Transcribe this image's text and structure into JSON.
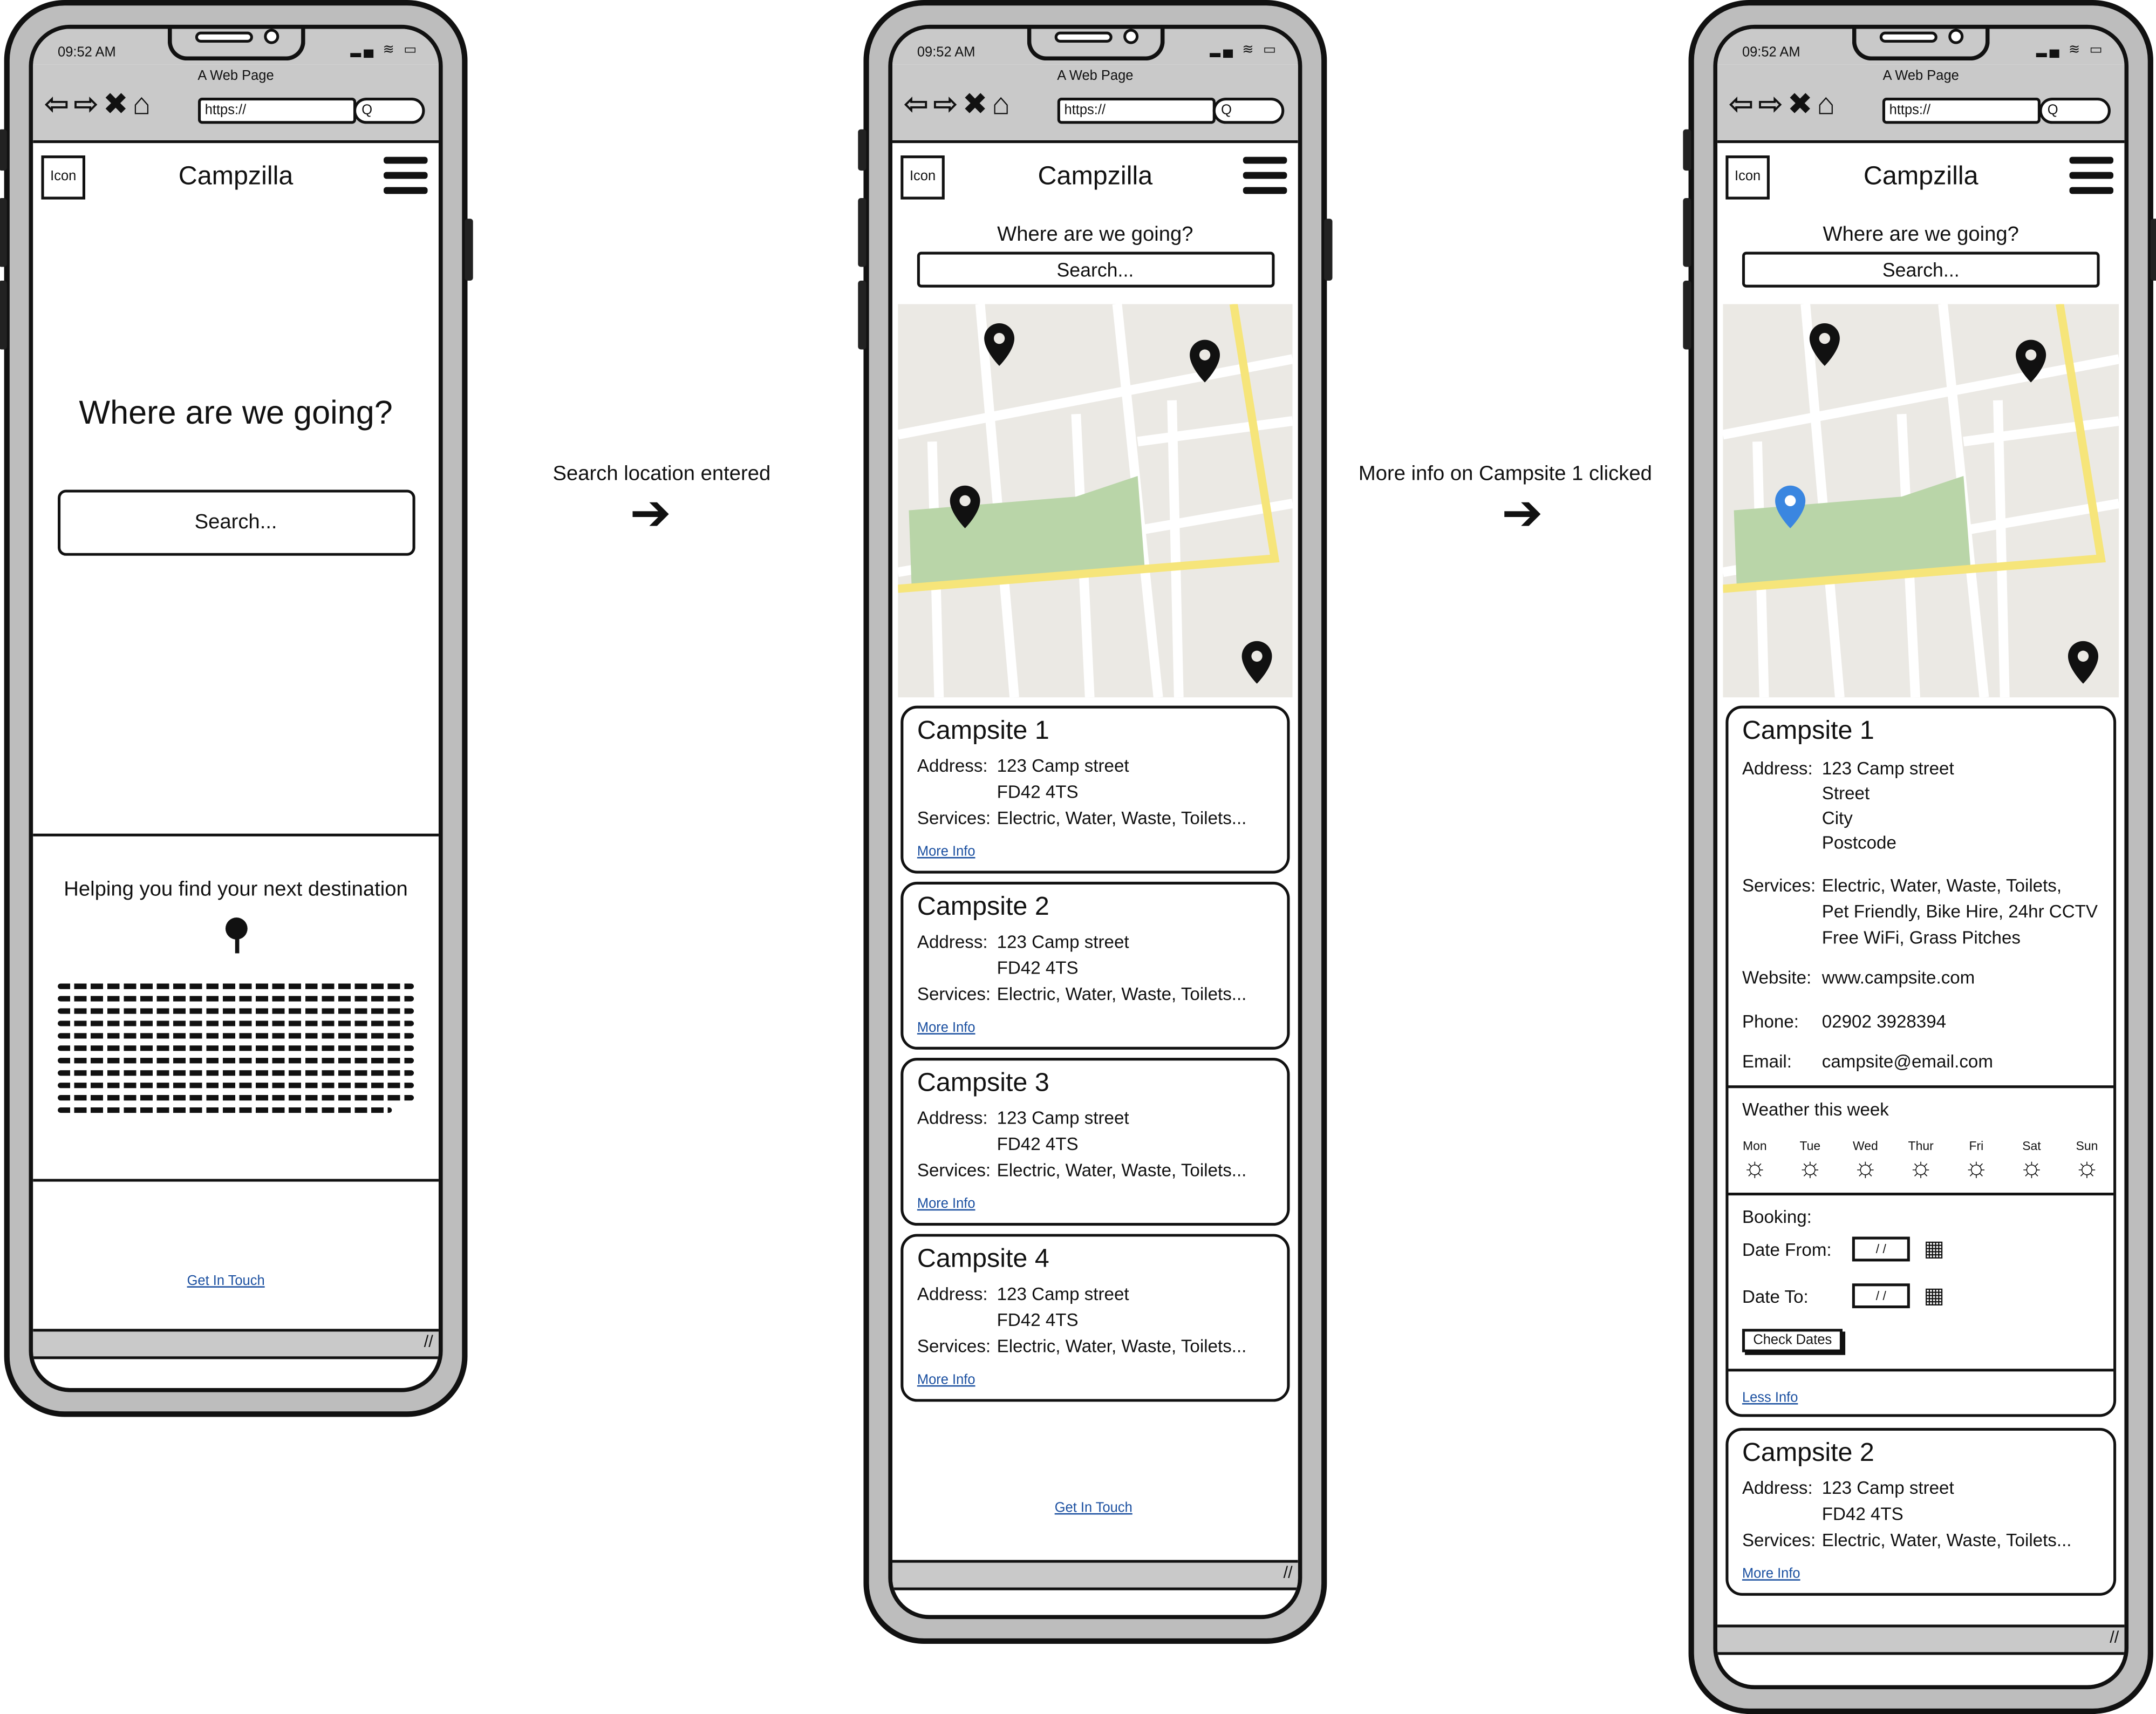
{
  "common": {
    "status_time": "09:52 AM",
    "page_title": "A Web Page",
    "url": "https://",
    "search_glyph": "Q",
    "icon_label": "Icon",
    "brand": "Campzilla",
    "subhead": "Where are we going?",
    "search_placeholder": "Search...",
    "footer_link": "Get In Touch",
    "more_info": "More Info",
    "less_info": "Less Info"
  },
  "transitions": [
    {
      "label": "Search location entered"
    },
    {
      "label": "More info on Campsite 1 clicked"
    }
  ],
  "screen1": {
    "hero": "Where are we going?",
    "search": "Search...",
    "tagline": "Helping you find your next destination"
  },
  "screen2": {
    "campsites": [
      {
        "title": "Campsite 1",
        "address_label": "Address:",
        "address_line1": "123 Camp street",
        "address_line2": "FD42 4TS",
        "services_label": "Services:",
        "services": "Electric, Water, Waste, Toilets..."
      },
      {
        "title": "Campsite 2",
        "address_label": "Address:",
        "address_line1": "123 Camp street",
        "address_line2": "FD42 4TS",
        "services_label": "Services:",
        "services": "Electric, Water, Waste, Toilets..."
      },
      {
        "title": "Campsite 3",
        "address_label": "Address:",
        "address_line1": "123 Camp street",
        "address_line2": "FD42 4TS",
        "services_label": "Services:",
        "services": "Electric, Water, Waste, Toilets..."
      },
      {
        "title": "Campsite 4",
        "address_label": "Address:",
        "address_line1": "123 Camp street",
        "address_line2": "FD42 4TS",
        "services_label": "Services:",
        "services": "Electric, Water, Waste, Toilets..."
      }
    ]
  },
  "screen3": {
    "detail": {
      "title": "Campsite 1",
      "address_label": "Address:",
      "address_lines": [
        "123 Camp street",
        "Street",
        "City",
        "Postcode"
      ],
      "services_label": "Services:",
      "services_lines": [
        "Electric, Water, Waste, Toilets,",
        "Pet Friendly, Bike Hire, 24hr CCTV",
        "Free WiFi, Grass Pitches"
      ],
      "website_label": "Website:",
      "website": "www.campsite.com",
      "phone_label": "Phone:",
      "phone": "02902 3928394",
      "email_label": "Email:",
      "email": "campsite@email.com",
      "weather_title": "Weather this week",
      "weather_days": [
        "Mon",
        "Tue",
        "Wed",
        "Thur",
        "Fri",
        "Sat",
        "Sun"
      ],
      "booking_label": "Booking:",
      "date_from_label": "Date From:",
      "date_to_label": "Date To:",
      "date_placeholder": "/ /",
      "check_dates": "Check Dates"
    },
    "next": {
      "title": "Campsite 2",
      "address_label": "Address:",
      "address_line1": "123 Camp street",
      "address_line2": "FD42 4TS",
      "services_label": "Services:",
      "services": "Electric, Water, Waste, Toilets..."
    }
  },
  "colors": {
    "map_bg": "#ebe9e4",
    "map_park": "#b9d5a8",
    "map_highway": "#f6e57a",
    "pin_selected": "#3a86e0",
    "link": "#1a4fa0"
  }
}
